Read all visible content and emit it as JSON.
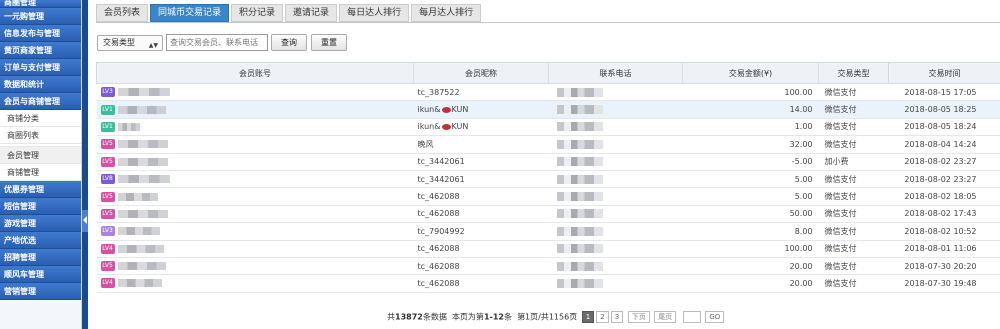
{
  "sidebar": {
    "items": [
      {
        "label": "商圈管理",
        "type": "header",
        "cls": "first"
      },
      {
        "label": "一元购管理",
        "type": "header"
      },
      {
        "label": "信息发布与管理",
        "type": "header"
      },
      {
        "label": "黄页商家管理",
        "type": "header"
      },
      {
        "label": "订单与支付管理",
        "type": "header"
      },
      {
        "label": "数据和统计",
        "type": "header"
      },
      {
        "label": "会员与商铺管理",
        "type": "header"
      },
      {
        "label": "商铺分类",
        "type": "sub"
      },
      {
        "label": "商圈列表",
        "type": "sub"
      },
      {
        "label": "",
        "type": "pad"
      },
      {
        "label": "会员管理",
        "type": "sub",
        "active": true
      },
      {
        "label": "商铺管理",
        "type": "sub"
      },
      {
        "label": "优惠券管理",
        "type": "header"
      },
      {
        "label": "短信管理",
        "type": "header"
      },
      {
        "label": "游戏管理",
        "type": "header"
      },
      {
        "label": "产地优选",
        "type": "header"
      },
      {
        "label": "招聘管理",
        "type": "header"
      },
      {
        "label": "顺风车管理",
        "type": "header"
      },
      {
        "label": "营销管理",
        "type": "header"
      }
    ]
  },
  "tabs": [
    {
      "label": "会员列表",
      "active": false
    },
    {
      "label": "同城币交易记录",
      "active": true
    },
    {
      "label": "积分记录",
      "active": false
    },
    {
      "label": "邀请记录",
      "active": false
    },
    {
      "label": "每日达人排行",
      "active": false
    },
    {
      "label": "每月达人排行",
      "active": false
    }
  ],
  "search": {
    "type_select": "交易类型",
    "placeholder": "查询交易会员、联系电话",
    "query_label": "查询",
    "reset_label": "重置"
  },
  "table": {
    "columns": [
      "会员账号",
      "会员昵称",
      "联系电话",
      "交易金额(¥)",
      "交易类型",
      "交易时间"
    ],
    "rows": [
      {
        "level": "LV3",
        "lvcolor": "#7b5bd6",
        "nick": "tc_387522",
        "lips": false,
        "amount": "100.00",
        "type": "微信支付",
        "time": "2018-08-15 17:05",
        "hl": false
      },
      {
        "level": "LV1",
        "lvcolor": "#3bbf9a",
        "nick": "ikun&",
        "nick2": "KUN",
        "lips": true,
        "amount": "14.00",
        "type": "微信支付",
        "time": "2018-08-05 18:25",
        "hl": true
      },
      {
        "level": "LV1",
        "lvcolor": "#3bbf9a",
        "nick": "ikun&",
        "nick2": "KUN",
        "lips": true,
        "amount": "1.00",
        "type": "微信支付",
        "time": "2018-08-05 18:24",
        "hl": false
      },
      {
        "level": "LV5",
        "lvcolor": "#d94fa5",
        "nick": "晚风",
        "lips": false,
        "amount": "32.00",
        "type": "微信支付",
        "time": "2018-08-04 14:24",
        "hl": false
      },
      {
        "level": "LV5",
        "lvcolor": "#d94fa5",
        "nick": "tc_3442061",
        "lips": false,
        "amount": "-5.00",
        "type": "加小费",
        "time": "2018-08-02 23:27",
        "hl": false
      },
      {
        "level": "LV8",
        "lvcolor": "#7b5bd6",
        "nick": "tc_3442061",
        "lips": false,
        "amount": "5.00",
        "type": "微信支付",
        "time": "2018-08-02 23:27",
        "hl": false
      },
      {
        "level": "LV5",
        "lvcolor": "#d94fa5",
        "nick": "tc_462088",
        "lips": false,
        "amount": "5.00",
        "type": "微信支付",
        "time": "2018-08-02 18:05",
        "hl": false
      },
      {
        "level": "LV5",
        "lvcolor": "#d94fa5",
        "nick": "tc_462088",
        "lips": false,
        "amount": "50.00",
        "type": "微信支付",
        "time": "2018-08-02 17:43",
        "hl": false
      },
      {
        "level": "LV3",
        "lvcolor": "#a884e0",
        "nick": "tc_7904992",
        "lips": false,
        "amount": "8.00",
        "type": "微信支付",
        "time": "2018-08-02 10:52",
        "hl": false
      },
      {
        "level": "LV4",
        "lvcolor": "#d94fa5",
        "nick": "tc_462088",
        "lips": false,
        "amount": "100.00",
        "type": "微信支付",
        "time": "2018-08-01 11:06",
        "hl": false
      },
      {
        "level": "LV5",
        "lvcolor": "#d94fa5",
        "nick": "tc_462088",
        "lips": false,
        "amount": "20.00",
        "type": "微信支付",
        "time": "2018-07-30 20:20",
        "hl": false
      },
      {
        "level": "LV4",
        "lvcolor": "#d94fa5",
        "nick": "tc_462088",
        "lips": false,
        "amount": "20.00",
        "type": "微信支付",
        "time": "2018-07-30 19:48",
        "hl": false
      }
    ]
  },
  "pager": {
    "total_prefix": "共",
    "total_count": "13872",
    "total_suffix": "条数据",
    "range_prefix": "本页为第",
    "range": "1-12",
    "range_suffix": "条",
    "page_info": "第1页/共1156页",
    "pages": [
      "1",
      "2",
      "3"
    ],
    "next_label": "下页",
    "last_label": "尾页",
    "go_label": "GO"
  }
}
